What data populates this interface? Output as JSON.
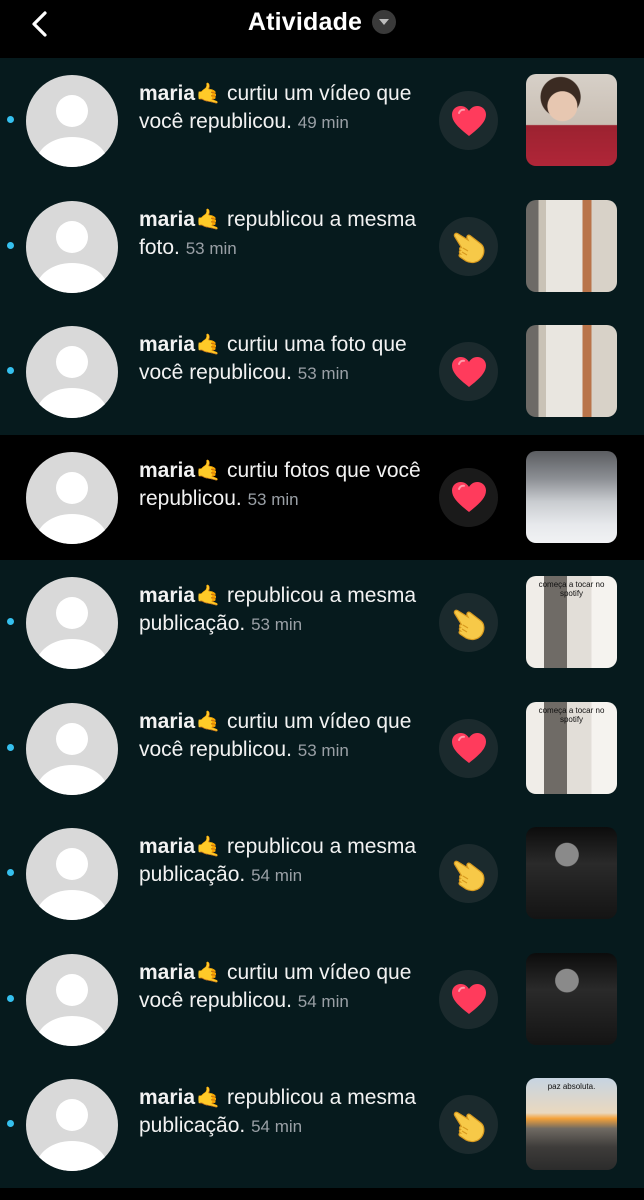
{
  "header": {
    "title": "Atividade",
    "back_icon": "chevron-left-icon",
    "dropdown_icon": "chevron-down-icon"
  },
  "colors": {
    "background": "#000000",
    "row_bg": "#061a1d",
    "unread_dot": "#35c0ee",
    "heart": "#ff3b5c",
    "hand": "#f7c948"
  },
  "notifications": [
    {
      "user": "maria",
      "emoji": "🤙",
      "text": "curtiu um vídeo que você republicou.",
      "time": "49 min",
      "icon": "heart-icon",
      "unread": true,
      "selected": false,
      "thumb": "t1"
    },
    {
      "user": "maria",
      "emoji": "🤙",
      "text": "republicou a mesma foto.",
      "time": "53 min",
      "icon": "pointing-hand-icon",
      "unread": true,
      "selected": false,
      "thumb": "t2"
    },
    {
      "user": "maria",
      "emoji": "🤙",
      "text": "curtiu uma foto que você republicou.",
      "time": "53 min",
      "icon": "heart-icon",
      "unread": true,
      "selected": false,
      "thumb": "t2"
    },
    {
      "user": "maria",
      "emoji": "🤙",
      "text": "curtiu fotos que você republicou.",
      "time": "53 min",
      "icon": "heart-icon",
      "unread": false,
      "selected": true,
      "thumb": "t3"
    },
    {
      "user": "maria",
      "emoji": "🤙",
      "text": "republicou a mesma publicação.",
      "time": "53 min",
      "icon": "pointing-hand-icon",
      "unread": true,
      "selected": false,
      "thumb": "t4"
    },
    {
      "user": "maria",
      "emoji": "🤙",
      "text": "curtiu um vídeo que você republicou.",
      "time": "53 min",
      "icon": "heart-icon",
      "unread": true,
      "selected": false,
      "thumb": "t4"
    },
    {
      "user": "maria",
      "emoji": "🤙",
      "text": "republicou a mesma publicação.",
      "time": "54 min",
      "icon": "pointing-hand-icon",
      "unread": true,
      "selected": false,
      "thumb": "t5"
    },
    {
      "user": "maria",
      "emoji": "🤙",
      "text": "curtiu um vídeo que você republicou.",
      "time": "54 min",
      "icon": "heart-icon",
      "unread": true,
      "selected": false,
      "thumb": "t5"
    },
    {
      "user": "maria",
      "emoji": "🤙",
      "text": "republicou a mesma publicação.",
      "time": "54 min",
      "icon": "pointing-hand-icon",
      "unread": true,
      "selected": false,
      "thumb": "t6"
    }
  ],
  "thumb_captions": {
    "t4": "começa a tocar no spotify",
    "t6": "paz absoluta."
  }
}
